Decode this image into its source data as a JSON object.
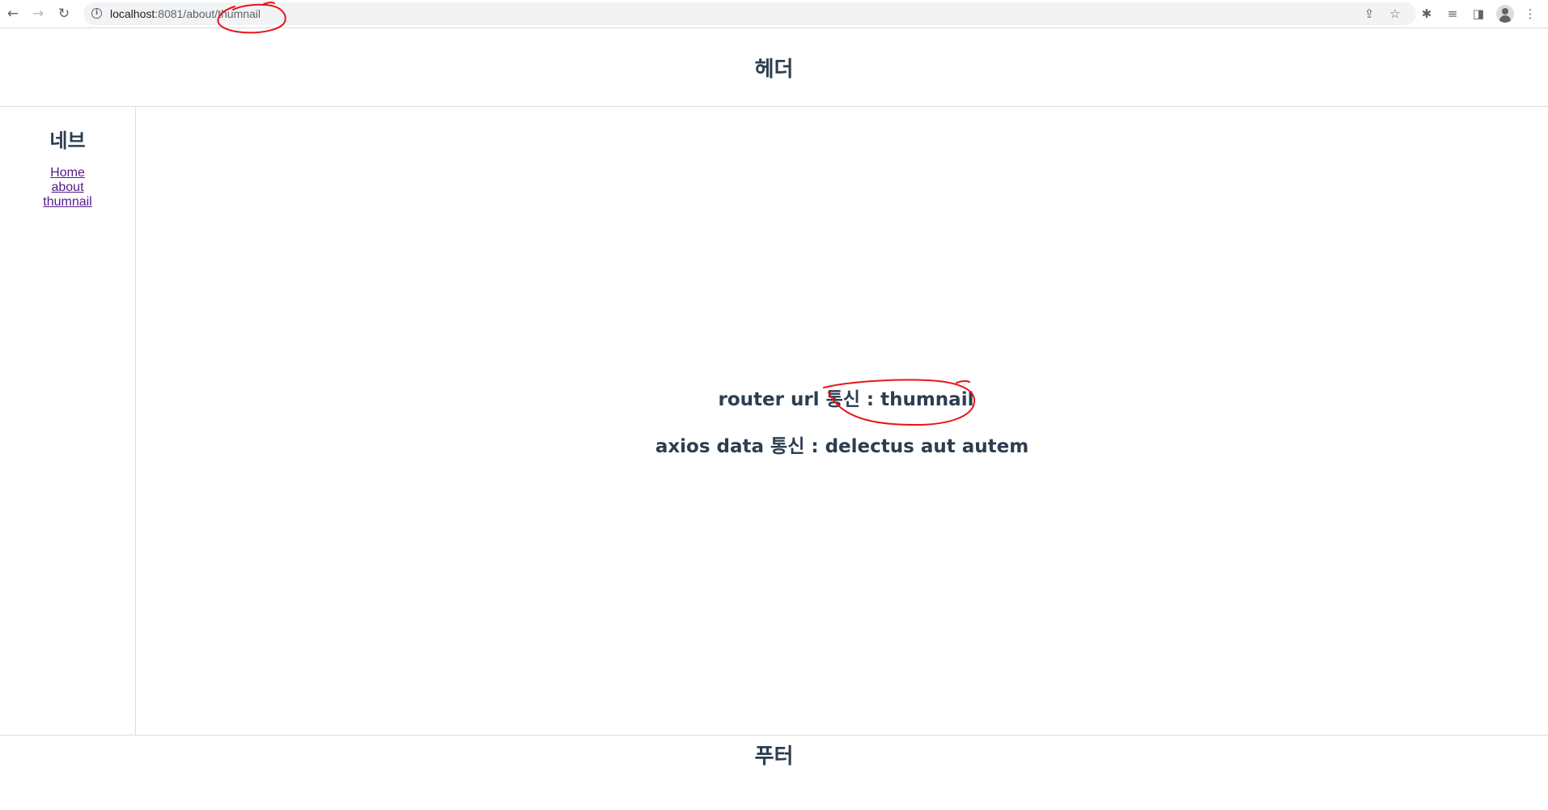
{
  "browser": {
    "back_icon": "←",
    "forward_icon": "→",
    "reload_icon": "↻",
    "info_icon": "i",
    "url_host": "localhost",
    "url_rest": ":8081/about/thumnail",
    "share_icon": "⇪",
    "bookmark_icon": "☆",
    "extensions_icon": "✱",
    "media_icon": "≡",
    "sidepanel_icon": "◨",
    "menu_icon": "⋮"
  },
  "header": {
    "title": "헤더"
  },
  "sidebar": {
    "title": "네브",
    "links": [
      {
        "label": "Home"
      },
      {
        "label": "about"
      },
      {
        "label": "thumnail"
      }
    ]
  },
  "main": {
    "router_line": "router url 통신 : thumnail",
    "axios_line": "axios data 통신 : delectus aut autem"
  },
  "footer": {
    "title": "푸터"
  },
  "annotation_color": "#e8141a"
}
